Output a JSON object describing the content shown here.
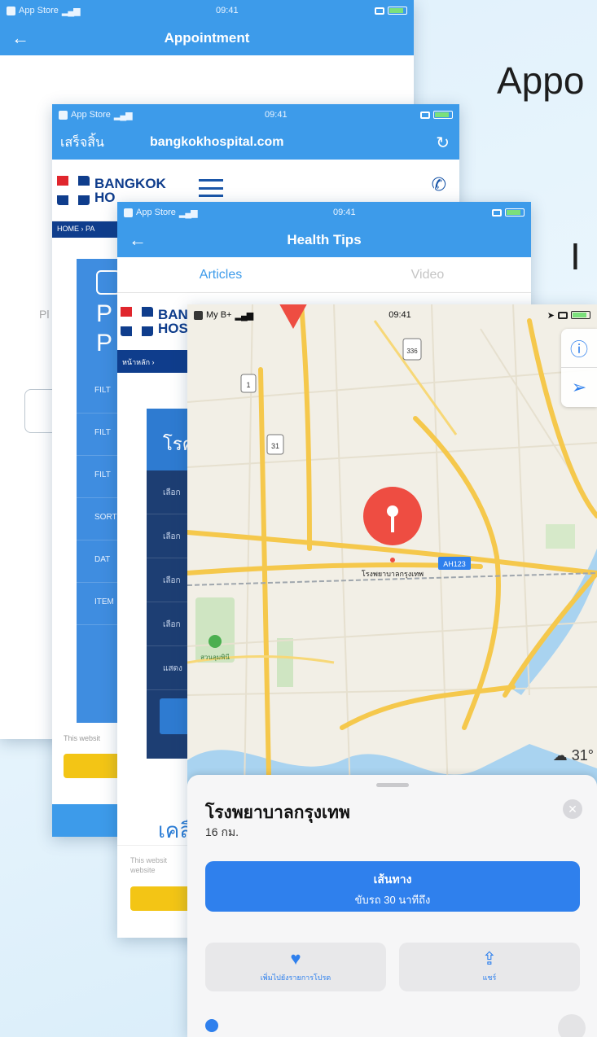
{
  "side_headings": {
    "title": "Appo",
    "subtitle": "I"
  },
  "appointment_screen": {
    "status": {
      "carrier": "App Store",
      "time": "09:41"
    },
    "nav_title": "Appointment",
    "partial_label": "Pl"
  },
  "browser_screen": {
    "status": {
      "carrier": "App Store",
      "time": "09:41"
    },
    "done_label": "เสร็จสิ้น",
    "url": "bangkokhospital.com",
    "logo_line1": "BANGKOK",
    "logo_line2": "HO",
    "breadcrumb": "HOME › PA",
    "panel_heading_1": "P",
    "panel_heading_2": "P",
    "filters": [
      "FILT",
      "FILT",
      "FILT",
      "SORT",
      "DAT",
      "ITEM"
    ],
    "cookie_text": "This websit"
  },
  "health_tips_screen": {
    "status": {
      "carrier": "App Store",
      "time": "09:41"
    },
    "nav_title": "Health Tips",
    "tabs": [
      {
        "label": "Articles",
        "active": true
      },
      {
        "label": "Video",
        "active": false
      }
    ],
    "logo_line1": "BAN",
    "logo_line2": "HOS",
    "breadcrumb": "หน้าหลัก › ",
    "dark_panel_heading": "โรค",
    "dark_panel_rows": [
      "เลือก",
      "เลือก",
      "เลือก",
      "เลือก",
      "แสดง"
    ],
    "section_heading": "เคลื่",
    "cookie_text": "This websit website"
  },
  "maps_screen": {
    "status": {
      "carrier": "My B+",
      "time": "09:41"
    },
    "map_labels": {
      "pin_label": "โรงพยาบาลกรุงเทพ",
      "road_badge": "AH123",
      "park_label": "สวนลุมพินี",
      "shield_1": "1",
      "shield_31": "31",
      "shield_336": "336"
    },
    "weather": "31°",
    "place_name": "โรงพยาบาลกรุงเทพ",
    "distance": "16 กม.",
    "directions_label": "เส้นทาง",
    "directions_eta": "ขับรถ 30 นาทีถึง",
    "favorite_label": "เพิ่มไปยังรายการโปรด",
    "share_label": "แชร์",
    "colors": {
      "accent": "#2f80ed",
      "pin": "#ee4d42",
      "road_major": "#f5c84c",
      "water": "#a9d3f0"
    }
  },
  "theme": {
    "nav_blue": "#3d9bea",
    "brand_navy": "#0f3d8c",
    "brand_red": "#e0262d",
    "cookie_yellow": "#f3c515"
  }
}
